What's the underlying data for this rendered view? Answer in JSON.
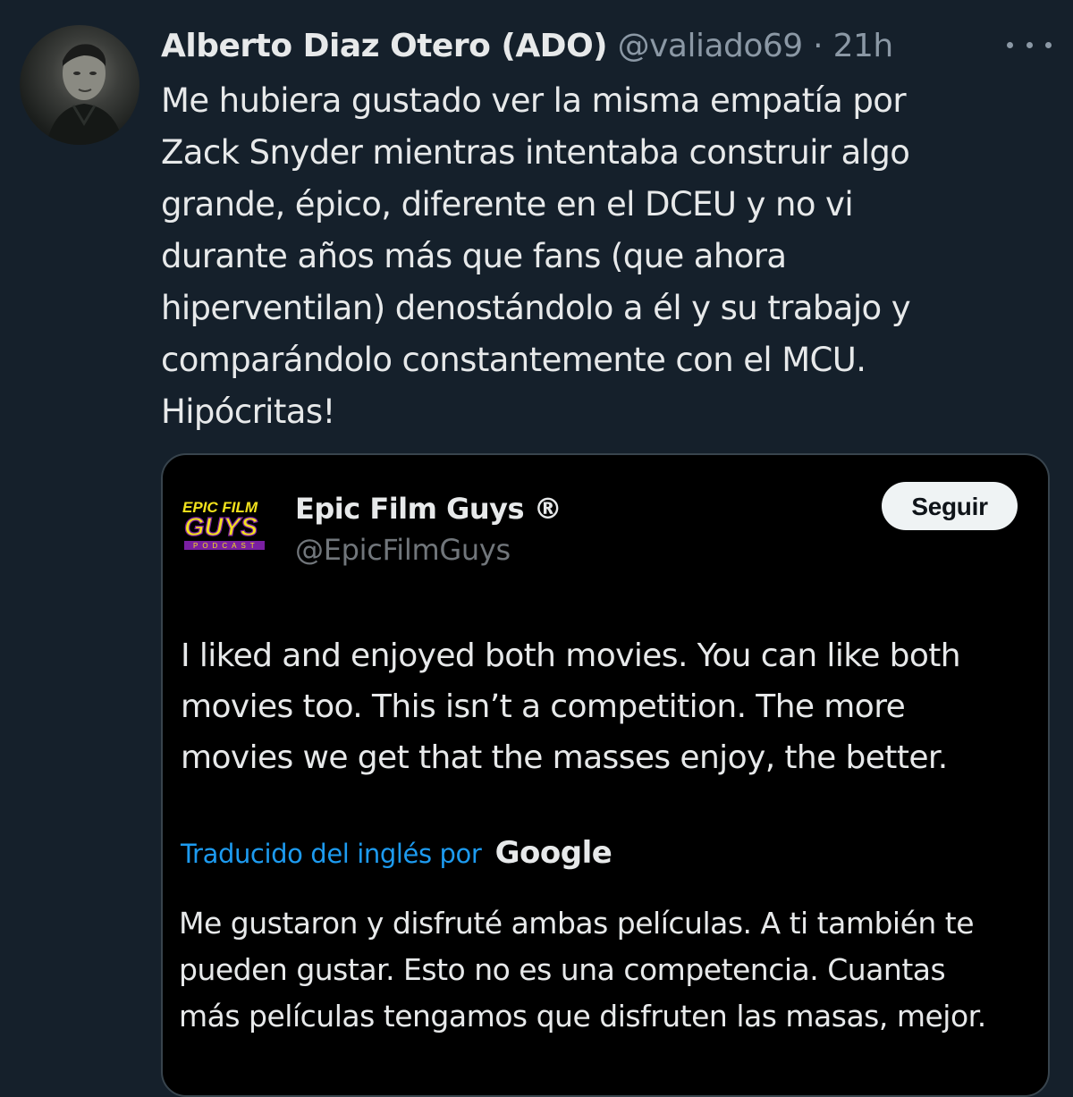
{
  "tweet": {
    "author": {
      "display_name": "Alberto Diaz Otero (ADO)",
      "handle": "@valiado69",
      "separator": "·",
      "time": "21h"
    },
    "text": "Me hubiera gustado ver la misma empatía por\nZack Snyder mientras intentaba construir algo\ngrande, épico, diferente en el DCEU y no vi\ndurante años más que fans (que ahora\nhiperventilan) denostándolo a él y su trabajo y\ncomparándolo constantemente con el MCU.\nHipócritas!",
    "more_icon": "ellipsis-icon"
  },
  "quoted_tweet": {
    "author": {
      "display_name": "Epic Film Guys ®",
      "handle": "@EpicFilmGuys",
      "logo_text": [
        "EPIC FILM",
        "GUYS",
        "PODCAST"
      ]
    },
    "follow_label": "Seguir",
    "original_text": "I liked and enjoyed both movies. You can like both\nmovies too. This isn’t a competition. The more\nmovies we get that the masses enjoy, the better.",
    "translation": {
      "label": "Traducido del inglés por",
      "provider": "Google"
    },
    "translated_text": "Me gustaron y disfruté ambas películas. A ti también te\npueden gustar. Esto no es una competencia. Cuantas\nmás películas tengamos que disfruten las masas, mejor."
  },
  "colors": {
    "background": "#15202b",
    "quote_background": "#000000",
    "text": "#e7e9ea",
    "secondary_text": "#8b98a5",
    "link": "#1d9bf0",
    "border": "#38444d",
    "logo_yellow": "#f2e21c",
    "logo_purple": "#7a1fa2"
  }
}
